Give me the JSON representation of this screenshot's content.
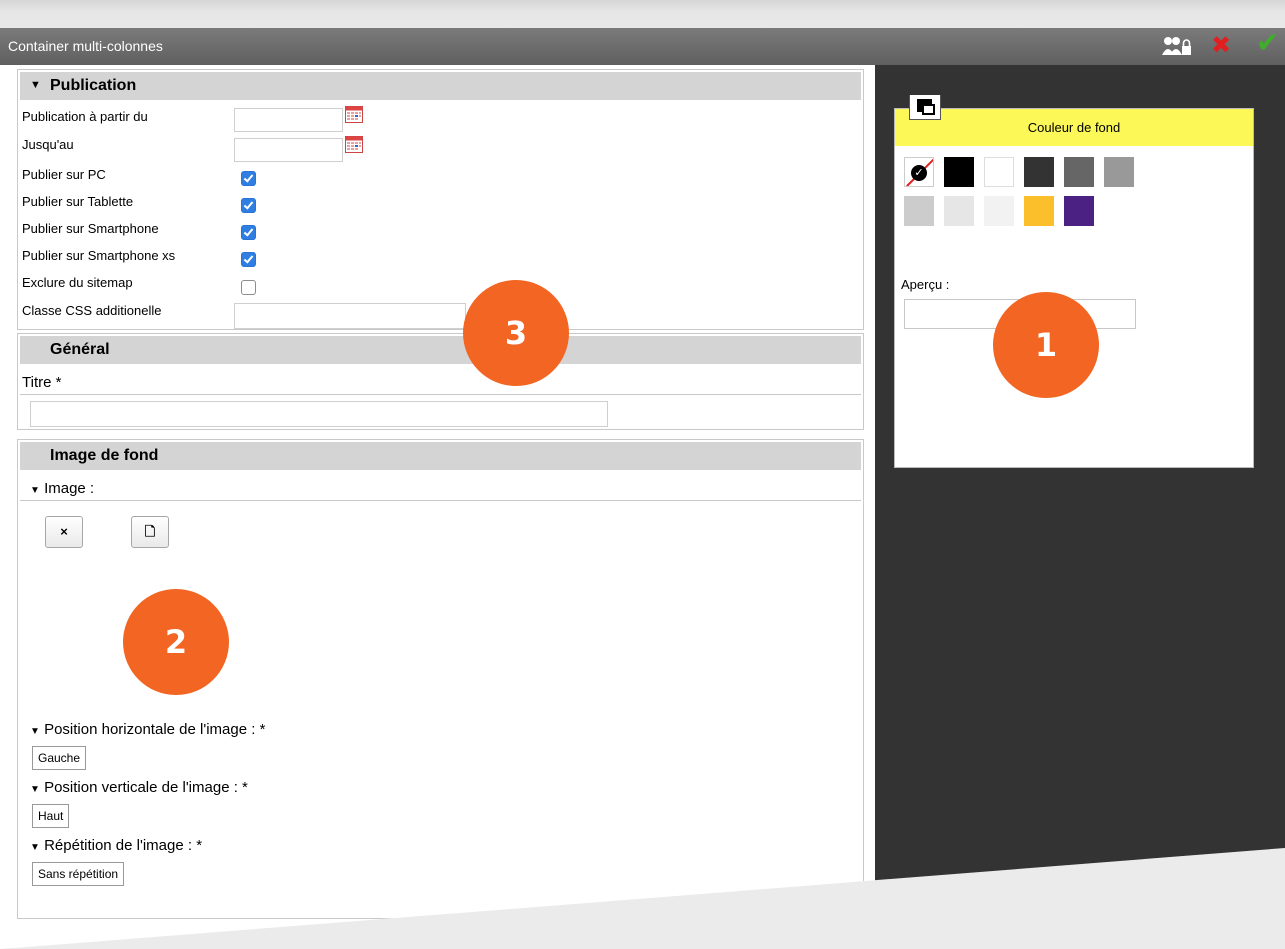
{
  "window": {
    "title": "Container multi-colonnes",
    "icons": {
      "users": "users-lock-icon",
      "close": "close-icon",
      "confirm": "check-icon"
    },
    "close_glyph": "✖",
    "confirm_glyph": "✔"
  },
  "sections": {
    "publication": {
      "header": "Publication",
      "rows": [
        {
          "label": "Publication à partir du",
          "type": "date",
          "value": ""
        },
        {
          "label": "Jusqu'au",
          "type": "date",
          "value": ""
        },
        {
          "label": "Publier sur PC",
          "type": "checkbox",
          "checked": true
        },
        {
          "label": "Publier sur Tablette",
          "type": "checkbox",
          "checked": true
        },
        {
          "label": "Publier sur Smartphone",
          "type": "checkbox",
          "checked": true
        },
        {
          "label": "Publier sur Smartphone xs",
          "type": "checkbox",
          "checked": true
        },
        {
          "label": "Exclure du sitemap",
          "type": "checkbox",
          "checked": false
        },
        {
          "label": "Classe CSS additionelle",
          "type": "text",
          "value": ""
        }
      ]
    },
    "general": {
      "header": "Général",
      "titre_label": "Titre *",
      "titre_value": ""
    },
    "background": {
      "header": "Image de fond",
      "image_label": "Image :",
      "remove_glyph": "×",
      "browse_glyph": "🗋",
      "h_position_label": "Position horizontale de l'image : *",
      "h_position_value": "Gauche",
      "v_position_label": "Position verticale de l'image : *",
      "v_position_value": "Haut",
      "repeat_label": "Répétition de l'image : *",
      "repeat_value": "Sans répétition"
    }
  },
  "color_panel": {
    "header": "Couleur de fond",
    "swatches_row1": [
      "none",
      "#000000",
      "#ffffff",
      "#333333",
      "#666666",
      "#999999"
    ],
    "swatches_row2": [
      "#cccccc",
      "#e6e6e6",
      "#f2f2f2",
      "#fbbf2b",
      "#4b2183"
    ],
    "apercu_label": "Aperçu :",
    "apercu_value": ""
  },
  "markers": {
    "one": "1",
    "two": "2",
    "three": "3"
  },
  "colors": {
    "marker": "#f26522",
    "panel_header": "#fbf858",
    "checkbox": "#2f7fe3"
  }
}
